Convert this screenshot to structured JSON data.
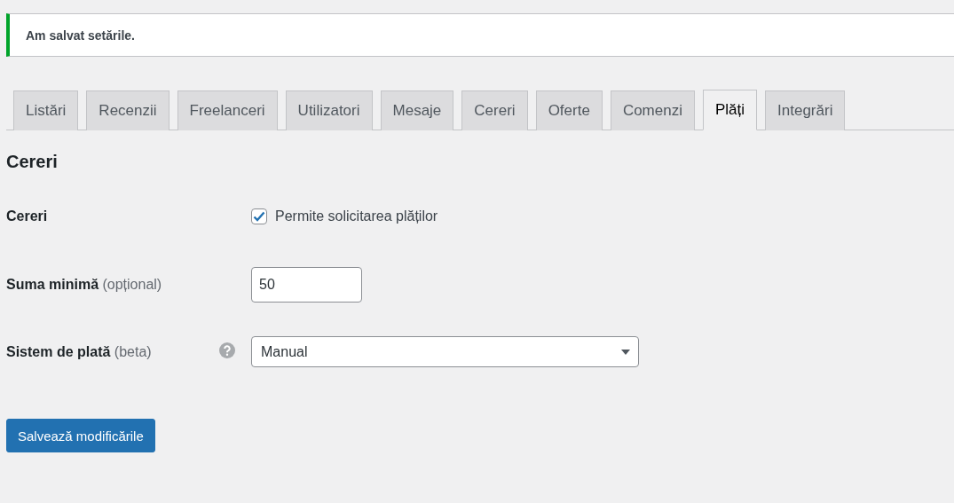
{
  "notice": {
    "message": "Am salvat setările."
  },
  "tabs": [
    {
      "label": "Listări",
      "selected": false
    },
    {
      "label": "Recenzii",
      "selected": false
    },
    {
      "label": "Freelanceri",
      "selected": false
    },
    {
      "label": "Utilizatori",
      "selected": false
    },
    {
      "label": "Mesaje",
      "selected": false
    },
    {
      "label": "Cereri",
      "selected": false
    },
    {
      "label": "Oferte",
      "selected": false
    },
    {
      "label": "Comenzi",
      "selected": false
    },
    {
      "label": "Plăți",
      "selected": true
    },
    {
      "label": "Integrări",
      "selected": false
    }
  ],
  "section": {
    "title": "Cereri"
  },
  "fields": [
    {
      "kind": "checkbox",
      "label": "Cereri",
      "checked": true,
      "option": "Permite solicitarea plăților"
    },
    {
      "kind": "number",
      "label": "Suma minimă",
      "hint": "(opțional)",
      "value": "50"
    },
    {
      "kind": "select",
      "label": "Sistem de plată",
      "hint": "(beta)",
      "help": true,
      "value": "Manual"
    }
  ],
  "save_button": "Salvează modificările"
}
